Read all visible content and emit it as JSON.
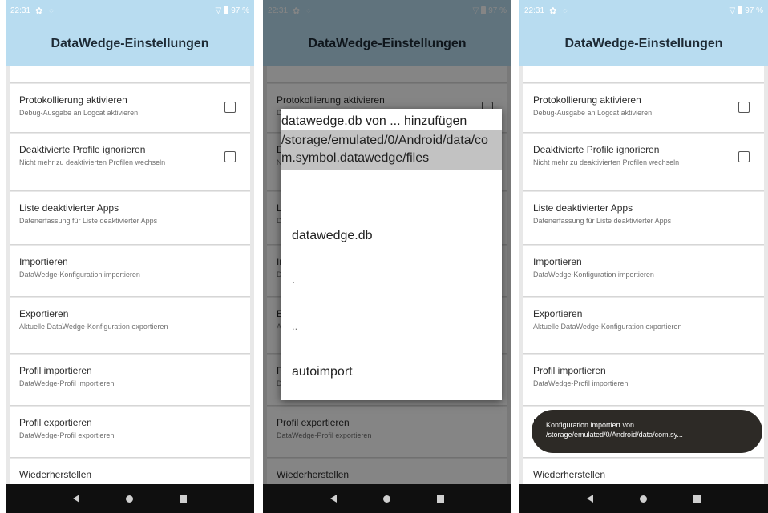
{
  "status": {
    "time": "22:31",
    "battery": "97 %"
  },
  "title": "DataWedge-Einstellungen",
  "settings": [
    {
      "title": "Protokollierung aktivieren",
      "subtitle": "Debug-Ausgabe an Logcat aktivieren"
    },
    {
      "title": "Deaktivierte Profile ignorieren",
      "subtitle": "Nicht mehr zu deaktivierten Profilen wechseln"
    },
    {
      "title": "Liste deaktivierter Apps",
      "subtitle": "Datenerfassung für Liste deaktivierter Apps"
    },
    {
      "title": "Importieren",
      "subtitle": "DataWedge-Konfiguration importieren"
    },
    {
      "title": "Exportieren",
      "subtitle": "Aktuelle DataWedge-Konfiguration exportieren"
    },
    {
      "title": "Profil importieren",
      "subtitle": "DataWedge-Profil importieren"
    },
    {
      "title": "Profil exportieren",
      "subtitle": "DataWedge-Profil exportieren"
    },
    {
      "title": "Wiederherstellen",
      "subtitle": ""
    }
  ],
  "dialog": {
    "title_line": "datawedge.db von ... hinzufügen",
    "path": "/storage/emulated/0/Android/data/com.symbol.datawedge/files",
    "items": [
      "datawedge.db",
      ".",
      "..",
      "autoimport"
    ]
  },
  "toast": {
    "line1": "Konfiguration importiert von",
    "line2": "/storage/emulated/0/Android/data/com.sy..."
  },
  "colors": {
    "header": "#b8dcf0",
    "navbar": "#0f0f0f",
    "toast": "#2d2a26"
  }
}
